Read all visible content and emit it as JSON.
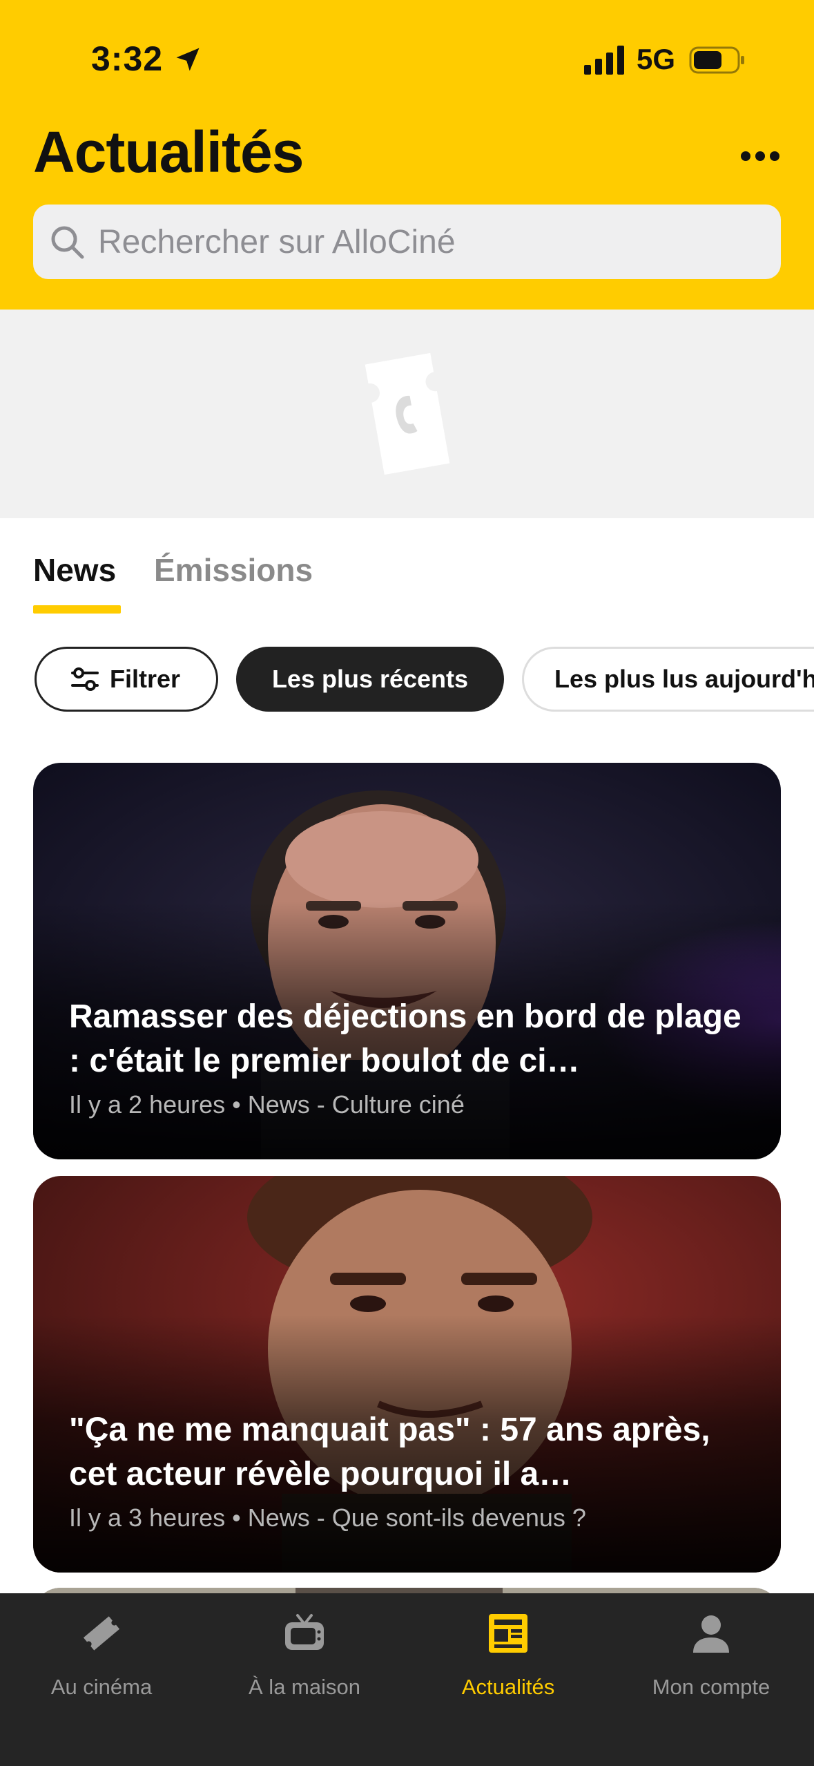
{
  "status_bar": {
    "time": "3:32",
    "network": "5G"
  },
  "header": {
    "title": "Actualités",
    "more_icon": "ellipsis-icon",
    "search_placeholder": "Rechercher sur AlloCiné"
  },
  "colors": {
    "brand_yellow": "#FFCC00",
    "dark": "#222222",
    "tabbar_bg": "#252525"
  },
  "tabs": [
    {
      "label": "News",
      "active": true
    },
    {
      "label": "Émissions",
      "active": false
    }
  ],
  "chips": [
    {
      "label": "Filtrer",
      "icon": "sliders-icon"
    },
    {
      "label": "Les plus récents",
      "selected": true
    },
    {
      "label": "Les plus lus aujourd'hui"
    }
  ],
  "articles": [
    {
      "title": "Ramasser des déjections en bord de plage : c'était le premier boulot de ci…",
      "meta": "Il y a 2 heures • News - Culture ciné"
    },
    {
      "title": "\"Ça ne me manquait pas\" : 57 ans après, cet acteur révèle pourquoi il a…",
      "meta": "Il y a 3 heures • News - Que sont-ils devenus ?"
    }
  ],
  "tabbar": [
    {
      "label": "Au cinéma",
      "icon": "ticket-icon"
    },
    {
      "label": "À la maison",
      "icon": "tv-icon"
    },
    {
      "label": "Actualités",
      "icon": "newspaper-icon",
      "active": true
    },
    {
      "label": "Mon compte",
      "icon": "person-icon"
    }
  ]
}
